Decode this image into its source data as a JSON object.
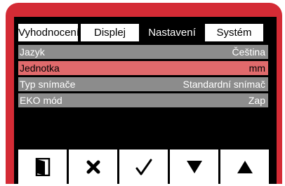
{
  "tabs": [
    {
      "label": "Vyhodnocení",
      "active": false
    },
    {
      "label": "Displej",
      "active": false
    },
    {
      "label": "Nastavení",
      "active": true
    },
    {
      "label": "Systém",
      "active": false
    }
  ],
  "settings": [
    {
      "label": "Jazyk",
      "value": "Čeština",
      "selected": false
    },
    {
      "label": "Jednotka",
      "value": "mm",
      "selected": true
    },
    {
      "label": "Typ snímače",
      "value": "Standardní snímač",
      "selected": false
    },
    {
      "label": "EKO mód",
      "value": "Zap",
      "selected": false
    }
  ],
  "buttons": [
    {
      "icon": "exit-door-icon"
    },
    {
      "icon": "close-icon"
    },
    {
      "icon": "check-icon"
    },
    {
      "icon": "arrow-down-icon"
    },
    {
      "icon": "arrow-up-icon"
    }
  ],
  "colors": {
    "frame": "#d42b35",
    "selected_row": "#e06a6c",
    "row": "#8c8c8c",
    "screen": "#000000"
  }
}
